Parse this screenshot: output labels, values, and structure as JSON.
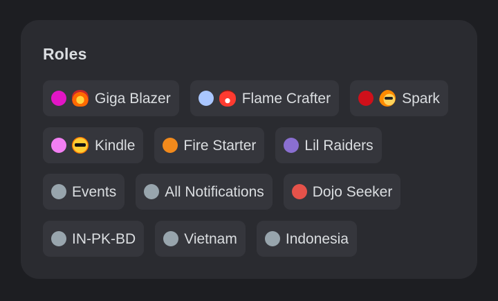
{
  "panel": {
    "title": "Roles"
  },
  "roles": [
    {
      "label": "Giga Blazer",
      "color": "#e215c6",
      "emoji": "fire-face-icon"
    },
    {
      "label": "Flame Crafter",
      "color": "#a9c6ff",
      "emoji": "flame-icon"
    },
    {
      "label": "Spark",
      "color": "#d0101a",
      "emoji": "comet-face-icon"
    },
    {
      "label": "Kindle",
      "color": "#f27ff2",
      "emoji": "cool-face-icon"
    },
    {
      "label": "Fire Starter",
      "color": "#f28a1c",
      "emoji": ""
    },
    {
      "label": "Lil Raiders",
      "color": "#8a6fd1",
      "emoji": ""
    },
    {
      "label": "Events",
      "color": "#98a5ad",
      "emoji": ""
    },
    {
      "label": "All Notifications",
      "color": "#98a5ad",
      "emoji": ""
    },
    {
      "label": "Dojo Seeker",
      "color": "#e5524a",
      "emoji": ""
    },
    {
      "label": "IN-PK-BD",
      "color": "#98a5ad",
      "emoji": ""
    },
    {
      "label": "Vietnam",
      "color": "#98a5ad",
      "emoji": ""
    },
    {
      "label": "Indonesia",
      "color": "#98a5ad",
      "emoji": ""
    }
  ]
}
